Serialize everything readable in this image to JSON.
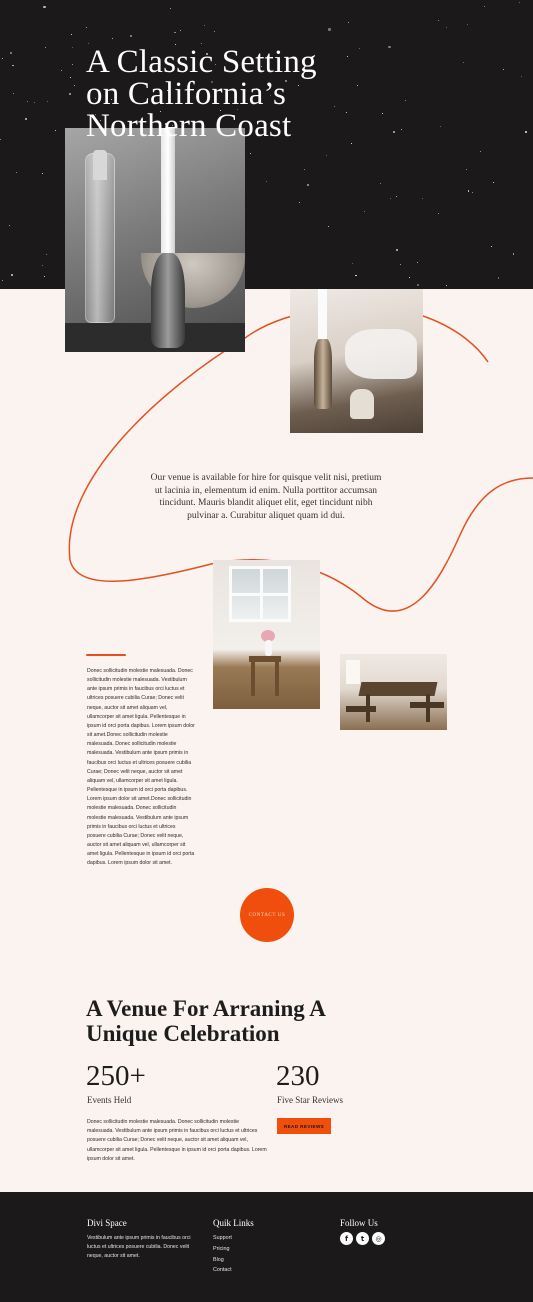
{
  "hero": {
    "title": "A Classic Setting\non California’s\nNorthern Coast"
  },
  "intro": {
    "text": "Our venue is available for hire for quisque velit nisi, pretium ut lacinia in, elementum id enim. Nulla porttitor accumsan tincidunt. Mauris blandit aliquet elit, eget tincidunt nibh pulvinar a. Curabitur aliquet quam id dui."
  },
  "about": {
    "body": "Donec sollicitudin molestie malesuada. Donec sollicitudin molestie malesuada. Vestibulum ante ipsum primis in faucibus orci luctus et ultrices posuere cubilia Curae; Donec velit neque, auctor sit amet aliquam vel, ullamcorper sit amet ligula. Pellentesque in ipsum id orci porta dapibus. Lorem ipsum dolor sit amet.Donec sollicitudin molestie malesuada. Donec sollicitudin molestie malesuada. Vestibulum ante ipsum primis in faucibus orci luctus et ultrices posuere cubilia Curae; Donec velit neque, auctor sit amet aliquam vel, ullamcorper sit amet ligula. Pellentesque in ipsum id orci porta dapibus. Lorem ipsum dolor sit amet.Donec sollicitudin molestie malesuada. Donec sollicitudin molestie malesuada. Vestibulum ante ipsum primis in faucibus orci luctus et ultrices posuere cubilia Curae; Donec velit neque, auctor sit amet aliquam vel, ullamcorper sit amet ligula. Pellentesque in ipsum id orci porta dapibus. Lorem ipsum dolor sit amet.",
    "contact_label": "CONTACT US"
  },
  "venue": {
    "title": "A Venue For Arraning A\nUnique Celebration",
    "stats": [
      {
        "number": "250+",
        "label": "Events Held"
      },
      {
        "number": "230",
        "label": "Five Star Reviews"
      }
    ],
    "body": "Donec sollicitudin molestie malesuada. Donec sollicitudin molestie malesuada. Vestibulum ante ipsum primis in faucibus orci luctus et ultrices posuere cubilia Curae; Donec velit neque, auctor sit amet aliquam vel, ullamcorper sit amet ligula. Pellentesque in ipsum id orci porta dapibus. Lorem ipsum dolor sit amet.",
    "button_label": "READ REVIEWS"
  },
  "footer": {
    "brand_title": "Divi Space",
    "brand_text": "Vestibulum ante ipsum primis in faucibus orci luctus et ultrices posuere cubilia. Donec velit neque, auctor sit amet.",
    "links_title": "Quik Links",
    "links": [
      "Support",
      "Pricing",
      "Blog",
      "Contact"
    ],
    "follow_title": "Follow Us",
    "socials": [
      {
        "icon": "facebook-icon",
        "glyph": "f"
      },
      {
        "icon": "twitter-icon",
        "glyph": "t"
      },
      {
        "icon": "instagram-icon",
        "glyph": "◎"
      }
    ]
  },
  "colors": {
    "dark": "#1b1919",
    "cream": "#fbf3ef",
    "accent": "#f04e0c",
    "curve": "#e2511f"
  }
}
